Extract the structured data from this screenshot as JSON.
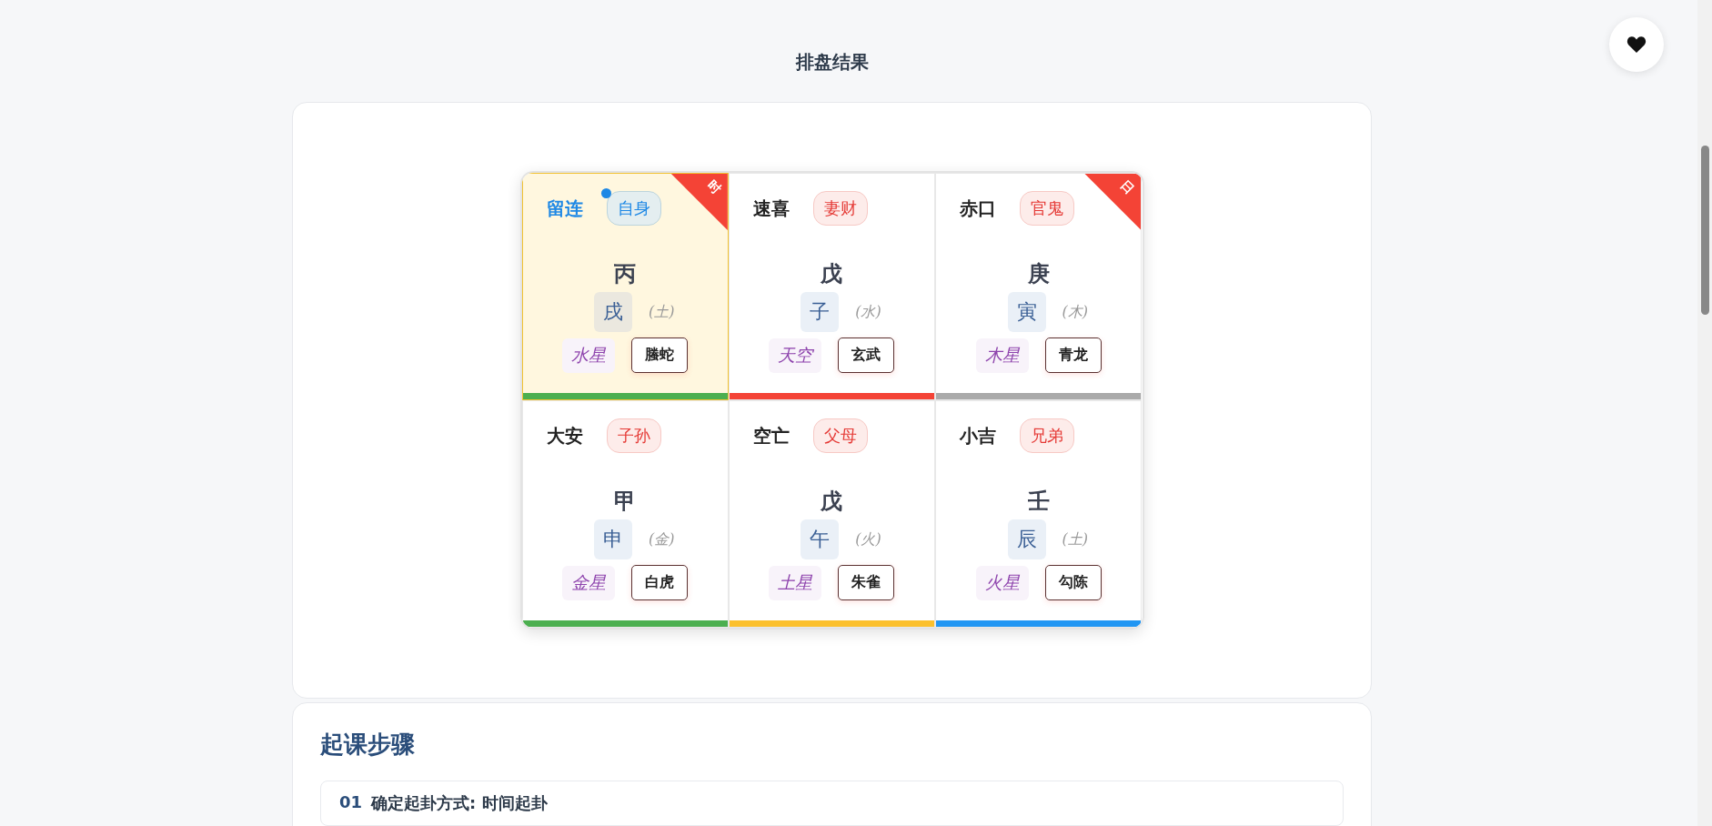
{
  "page_title": "排盘结果",
  "cells": [
    {
      "name": "留连",
      "relation": "自身",
      "kind": "self",
      "selected": true,
      "corner": "时",
      "stem": "丙",
      "branch": "戌",
      "element": "(土)",
      "star": "水星",
      "god": "螣蛇",
      "color": "#4caf50"
    },
    {
      "name": "速喜",
      "relation": "妻财",
      "kind": "kin",
      "selected": false,
      "stem": "戊",
      "branch": "子",
      "element": "(水)",
      "star": "天空",
      "god": "玄武",
      "color": "#f44336"
    },
    {
      "name": "赤口",
      "relation": "官鬼",
      "kind": "kin",
      "selected": false,
      "corner": "日",
      "stem": "庚",
      "branch": "寅",
      "element": "(木)",
      "star": "木星",
      "god": "青龙",
      "color": "#aaaaaa"
    },
    {
      "name": "大安",
      "relation": "子孙",
      "kind": "kin",
      "selected": false,
      "stem": "甲",
      "branch": "申",
      "element": "(金)",
      "star": "金星",
      "god": "白虎",
      "color": "#4caf50"
    },
    {
      "name": "空亡",
      "relation": "父母",
      "kind": "kin",
      "selected": false,
      "stem": "戊",
      "branch": "午",
      "element": "(火)",
      "star": "土星",
      "god": "朱雀",
      "color": "#fbc02d"
    },
    {
      "name": "小吉",
      "relation": "兄弟",
      "kind": "kin",
      "selected": false,
      "stem": "壬",
      "branch": "辰",
      "element": "(土)",
      "star": "火星",
      "god": "勾陈",
      "color": "#2196f3"
    }
  ],
  "steps": {
    "title": "起课步骤",
    "items": [
      {
        "number": "01",
        "text": "确定起卦方式: 时间起卦"
      }
    ]
  }
}
